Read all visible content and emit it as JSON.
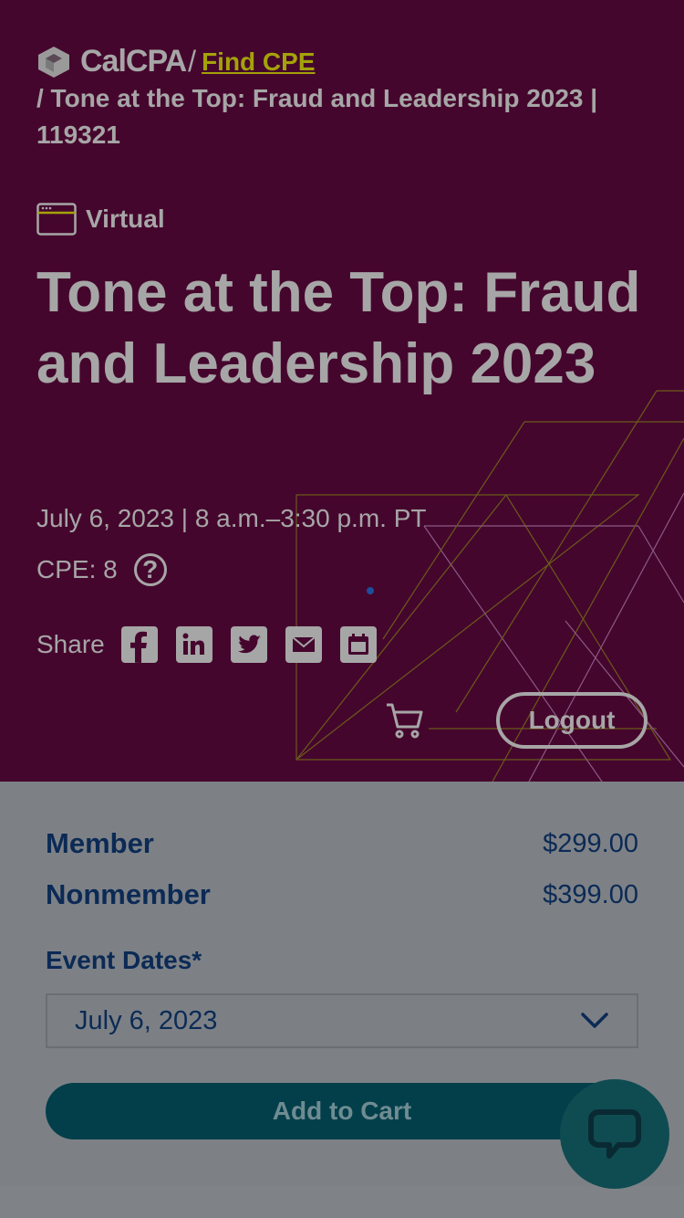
{
  "breadcrumb": {
    "logo": "CalCPA",
    "separator": "/",
    "link": "Find CPE",
    "current": "/ Tone at the Top: Fraud and Leadership 2023 | 119321"
  },
  "event": {
    "format": "Virtual",
    "title": "Tone at the Top: Fraud and Leadership 2023",
    "date_time": "July 6, 2023 | 8 a.m.–3:30 p.m. PT",
    "cpe": "CPE: 8",
    "help_glyph": "?"
  },
  "share": {
    "label": "Share",
    "icons": [
      "facebook-icon",
      "linkedin-icon",
      "twitter-icon",
      "email-icon",
      "calendar-icon"
    ]
  },
  "header_actions": {
    "logout_label": "Logout",
    "cart_icon": "cart-icon"
  },
  "pricing": {
    "member_label": "Member",
    "member_price": "$299.00",
    "nonmember_label": "Nonmember",
    "nonmember_price": "$399.00"
  },
  "event_dates": {
    "label": "Event Dates*",
    "selected": "July 6, 2023"
  },
  "add_to_cart_label": "Add to Cart",
  "colors": {
    "hero_bg": "#45062d",
    "link": "#a4a20a",
    "navy_text": "#0b2a55",
    "button_bg": "#033f4a",
    "chat_bg": "#0f4c52"
  }
}
